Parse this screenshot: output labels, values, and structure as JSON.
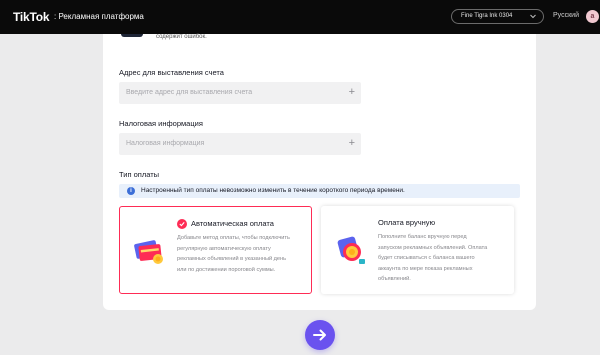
{
  "header": {
    "logo": "TikTok",
    "logo_sub": ": Рекламная платформа",
    "account": "Fine Tigra Ink 0304",
    "language": "Русский",
    "avatar_letter": "a"
  },
  "form": {
    "top_fragment": "содержит ошибок.",
    "billing_address": {
      "label": "Адрес для выставления счета",
      "placeholder": "Введите адрес для выставления счета"
    },
    "tax_info": {
      "label": "Налоговая информация",
      "placeholder": "Налоговая информация"
    },
    "payment_type": {
      "label": "Тип оплаты",
      "notice": "Настроенный тип оплаты невозможно изменить в течение короткого периода времени.",
      "options": [
        {
          "title": "Автоматическая оплата",
          "description": "Добавьте метод оплаты, чтобы подключить\nрегулярную автоматическую оплату\nрекламных объявлений в указанный день\nили по достижении пороговой суммы.",
          "selected": true
        },
        {
          "title": "Оплата вручную",
          "description": "Пополните баланс вручную перед\nзапуском рекламных объявлений. Оплата\nбудет списываться с баланса вашего\nаккаунта по мере показа рекламных\nобъявлений.",
          "selected": false
        }
      ]
    }
  },
  "colors": {
    "accent": "#fe2c55",
    "next_button": "#6a52ef",
    "notice_bg": "#e8f0fb",
    "info_icon": "#3d6fd7"
  },
  "icons": [
    "chevron-down-icon",
    "info-icon",
    "checkmark-icon",
    "credit-card-icon",
    "coins-icon",
    "arrow-right-icon"
  ]
}
